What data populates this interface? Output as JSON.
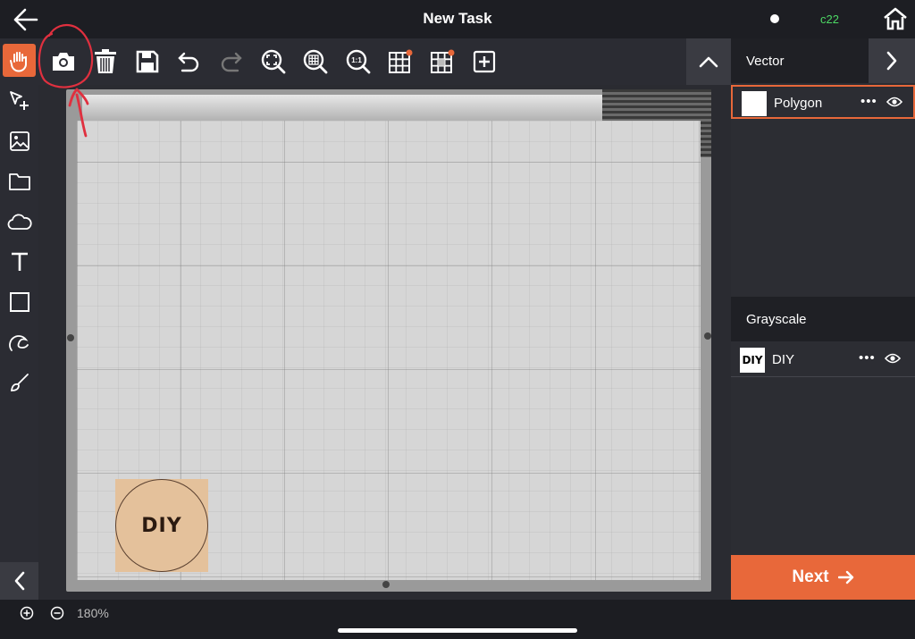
{
  "header": {
    "title": "New Task",
    "device_label": "c22",
    "device_color": "#4cd964"
  },
  "toolbar": {
    "items": [
      "camera-icon",
      "trash-icon",
      "save-icon",
      "undo-icon",
      "redo-icon",
      "zoom-fit-icon",
      "zoom-grid-icon",
      "zoom-1to1-icon",
      "grid-icon",
      "grid-settings-icon",
      "add-icon"
    ],
    "zoom_1to1_label": "1:1"
  },
  "left_tools": [
    "hand-icon",
    "select-add-icon",
    "image-icon",
    "folder-icon",
    "cloud-icon",
    "text-icon",
    "rectangle-icon",
    "draw-icon",
    "brush-icon"
  ],
  "panel": {
    "vector_title": "Vector",
    "grayscale_title": "Grayscale",
    "vector_layers": [
      {
        "name": "Polygon",
        "more": "•••"
      }
    ],
    "grayscale_layers": [
      {
        "name": "DIY",
        "thumb_text": "DIY",
        "more": "•••"
      }
    ]
  },
  "canvas": {
    "engrave_text": "DIY"
  },
  "next_label": "Next",
  "zoom_level": "180%",
  "colors": {
    "accent": "#e8683a",
    "annotation": "#e0303f"
  }
}
